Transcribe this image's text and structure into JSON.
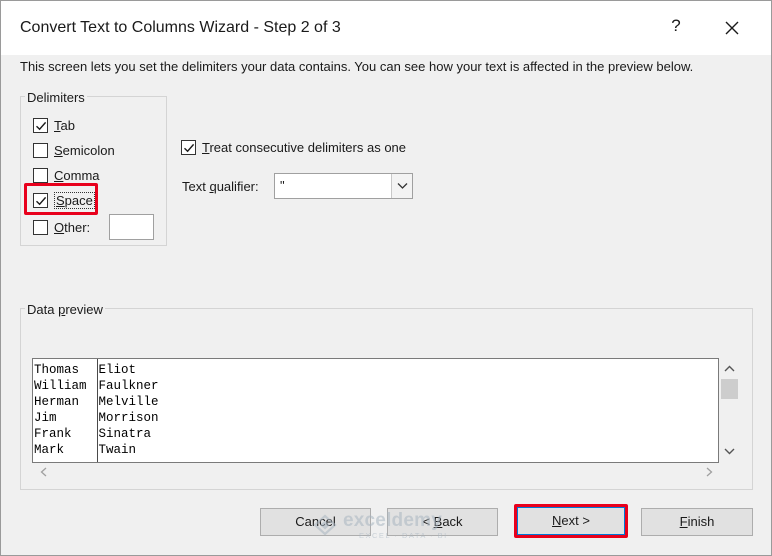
{
  "window": {
    "title": "Convert Text to Columns Wizard - Step 2 of 3",
    "help_label": "?",
    "close_icon": "close-icon"
  },
  "intro_text": "This screen lets you set the delimiters your data contains.  You can see how your text is affected in the preview below.",
  "delimiters": {
    "group_label": "Delimiters",
    "items": [
      {
        "key": "T",
        "rest": "ab",
        "checked": true
      },
      {
        "key": "S",
        "rest": "emicolon",
        "checked": false
      },
      {
        "key": "C",
        "rest": "omma",
        "checked": false
      },
      {
        "key": "S",
        "rest": "pace",
        "checked": true,
        "highlighted": true
      },
      {
        "key": "O",
        "rest": "ther:",
        "checked": false
      }
    ],
    "other_value": ""
  },
  "consecutive": {
    "key": "T",
    "rest": "reat consecutive delimiters as one",
    "checked": true
  },
  "qualifier": {
    "label_pre": "Text ",
    "label_key": "q",
    "label_rest": "ualifier:",
    "value": "\""
  },
  "preview": {
    "group_label_pre": "Data ",
    "group_label_key": "p",
    "group_label_rest": "review",
    "rows": [
      [
        "Thomas",
        "Eliot"
      ],
      [
        "William",
        "Faulkner"
      ],
      [
        "Herman",
        "Melville"
      ],
      [
        "Jim",
        "Morrison"
      ],
      [
        "Frank",
        "Sinatra"
      ],
      [
        "Mark",
        "Twain"
      ]
    ]
  },
  "buttons": {
    "cancel": "Cancel",
    "back_key": "B",
    "back_pre": "< ",
    "back_rest": "ack",
    "next_key": "N",
    "next_rest": "ext >",
    "finish_key": "F",
    "finish_rest": "inish"
  },
  "watermark": {
    "name": "exceldemy",
    "tagline": "EXCEL · DATA · BI"
  },
  "colors": {
    "highlight": "#e8001c",
    "focus_border": "#0078d7"
  }
}
